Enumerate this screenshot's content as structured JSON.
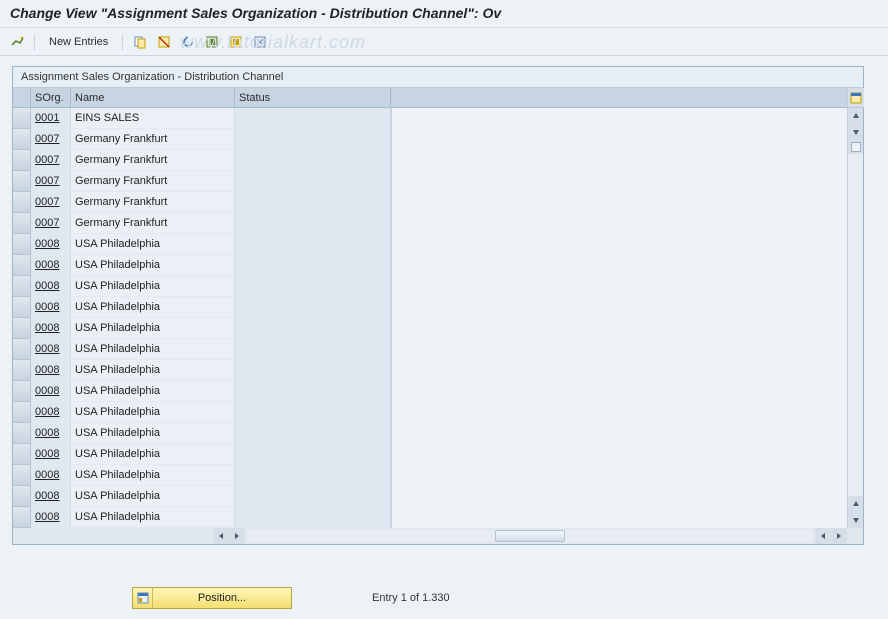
{
  "title": "Change View \"Assignment Sales Organization - Distribution Channel\": Ov",
  "toolbar": {
    "new_entries": "New Entries"
  },
  "watermark": "www.tutorialkart.com",
  "panel": {
    "title": "Assignment Sales Organization - Distribution Channel",
    "columns": {
      "sorg": "SOrg.",
      "name": "Name",
      "status": "Status"
    }
  },
  "rows": [
    {
      "sorg": "0001",
      "name": "EINS SALES",
      "status": ""
    },
    {
      "sorg": "0007",
      "name": "Germany Frankfurt",
      "status": ""
    },
    {
      "sorg": "0007",
      "name": "Germany Frankfurt",
      "status": ""
    },
    {
      "sorg": "0007",
      "name": "Germany Frankfurt",
      "status": ""
    },
    {
      "sorg": "0007",
      "name": "Germany Frankfurt",
      "status": ""
    },
    {
      "sorg": "0007",
      "name": "Germany Frankfurt",
      "status": ""
    },
    {
      "sorg": "0008",
      "name": "USA Philadelphia",
      "status": ""
    },
    {
      "sorg": "0008",
      "name": "USA Philadelphia",
      "status": ""
    },
    {
      "sorg": "0008",
      "name": "USA Philadelphia",
      "status": ""
    },
    {
      "sorg": "0008",
      "name": "USA Philadelphia",
      "status": ""
    },
    {
      "sorg": "0008",
      "name": "USA Philadelphia",
      "status": ""
    },
    {
      "sorg": "0008",
      "name": "USA Philadelphia",
      "status": ""
    },
    {
      "sorg": "0008",
      "name": "USA Philadelphia",
      "status": ""
    },
    {
      "sorg": "0008",
      "name": "USA Philadelphia",
      "status": ""
    },
    {
      "sorg": "0008",
      "name": "USA Philadelphia",
      "status": ""
    },
    {
      "sorg": "0008",
      "name": "USA Philadelphia",
      "status": ""
    },
    {
      "sorg": "0008",
      "name": "USA Philadelphia",
      "status": ""
    },
    {
      "sorg": "0008",
      "name": "USA Philadelphia",
      "status": ""
    },
    {
      "sorg": "0008",
      "name": "USA Philadelphia",
      "status": ""
    },
    {
      "sorg": "0008",
      "name": "USA Philadelphia",
      "status": ""
    }
  ],
  "footer": {
    "position_btn": "Position...",
    "entry_text": "Entry 1 of 1.330"
  }
}
